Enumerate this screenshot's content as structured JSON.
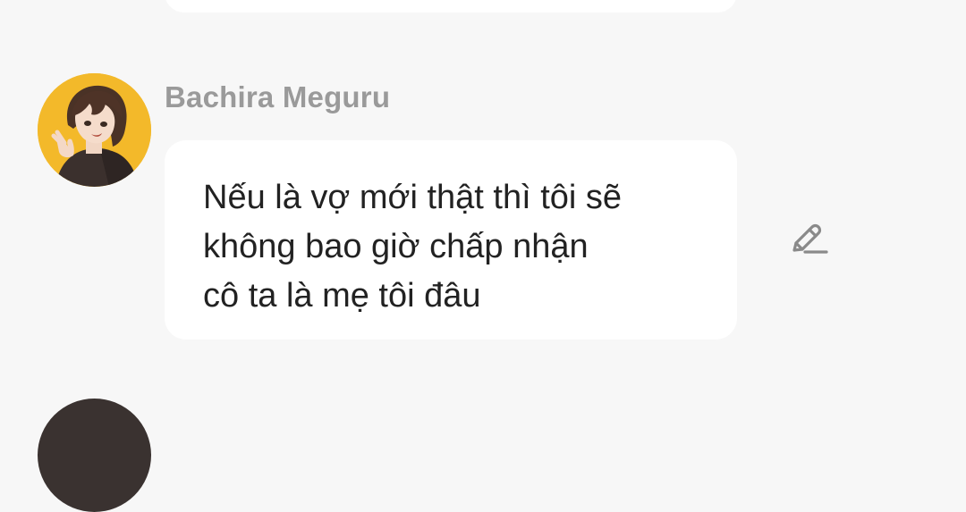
{
  "message": {
    "sender_name": "Bachira Meguru",
    "text": "Nếu là vợ mới thật thì tôi sẽ\nkhông bao giờ chấp nhận\ncô ta là mẹ tôi đâu",
    "avatar_icon": "character-avatar",
    "action_icon": "pencil-edit-icon"
  },
  "colors": {
    "background": "#f7f7f7",
    "bubble": "#ffffff",
    "sender_name": "#9a9a9a",
    "message_text": "#222222",
    "avatar_bg": "#f3b92a",
    "edit_icon": "#8a8a8a"
  }
}
